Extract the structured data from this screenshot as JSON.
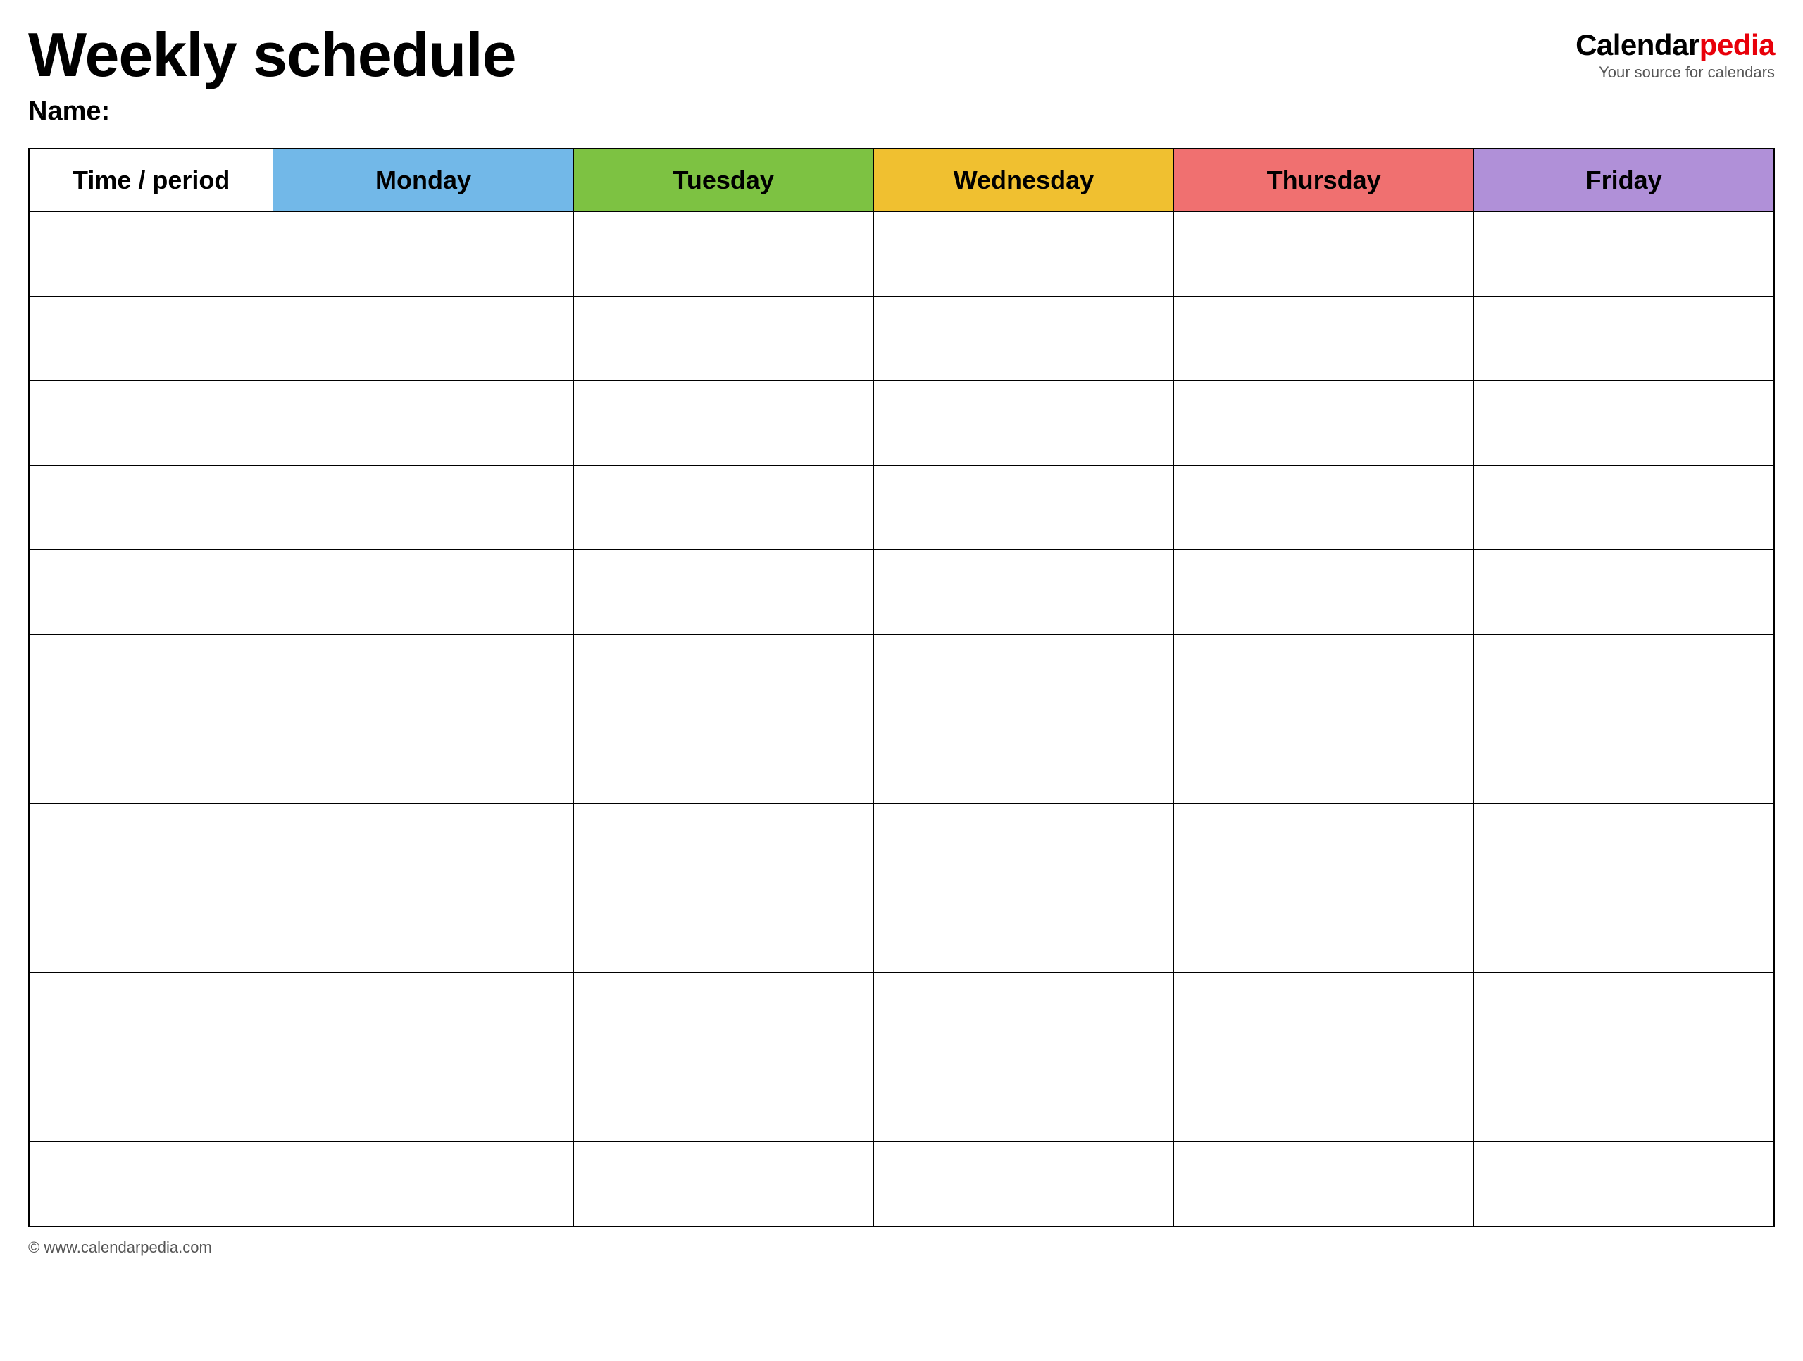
{
  "header": {
    "title": "Weekly schedule",
    "name_label": "Name:",
    "logo": {
      "calendar_part": "Calendar",
      "pedia_part": "pedia",
      "tagline": "Your source for calendars"
    }
  },
  "table": {
    "columns": [
      {
        "key": "time",
        "label": "Time / period",
        "color": "#ffffff"
      },
      {
        "key": "monday",
        "label": "Monday",
        "color": "#72b8e8"
      },
      {
        "key": "tuesday",
        "label": "Tuesday",
        "color": "#7dc242"
      },
      {
        "key": "wednesday",
        "label": "Wednesday",
        "color": "#f0c030"
      },
      {
        "key": "thursday",
        "label": "Thursday",
        "color": "#f07070"
      },
      {
        "key": "friday",
        "label": "Friday",
        "color": "#b090d8"
      }
    ],
    "row_count": 12
  },
  "footer": {
    "text": "© www.calendarpedia.com"
  }
}
